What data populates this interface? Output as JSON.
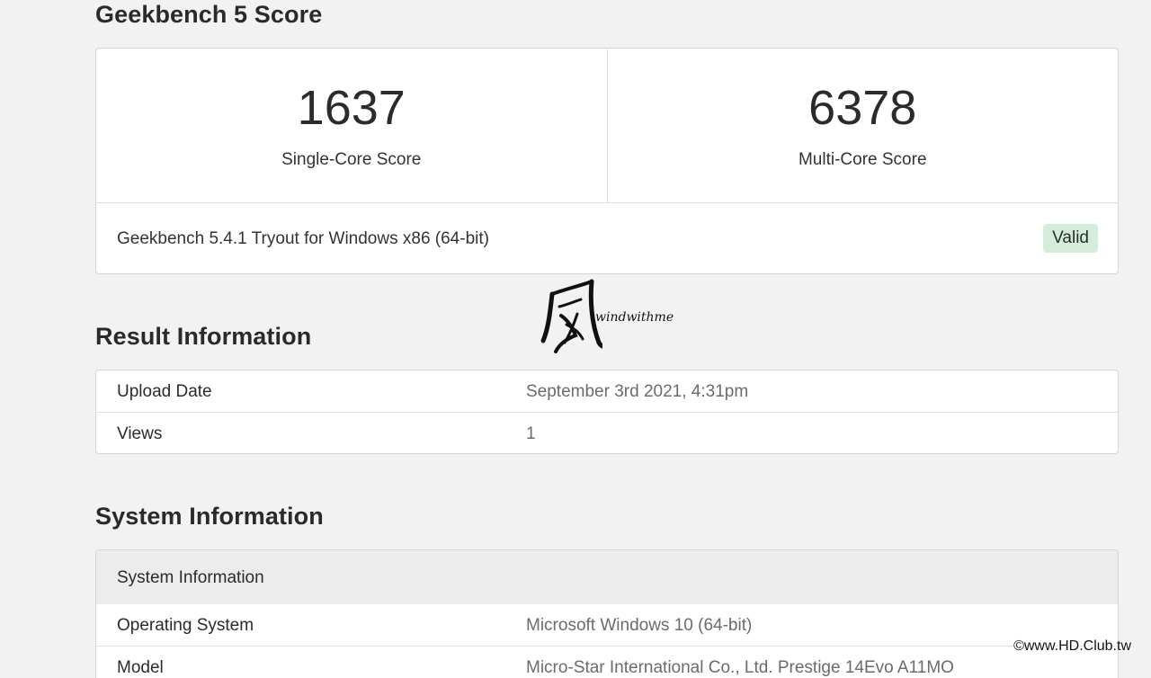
{
  "score_section": {
    "title": "Geekbench 5 Score",
    "single_core_value": "1637",
    "single_core_label": "Single-Core Score",
    "multi_core_value": "6378",
    "multi_core_label": "Multi-Core Score",
    "version": "Geekbench 5.4.1 Tryout for Windows x86 (64-bit)",
    "valid_badge": "Valid"
  },
  "result_section": {
    "title": "Result Information",
    "rows": [
      {
        "label": "Upload Date",
        "value": "September 3rd 2021, 4:31pm"
      },
      {
        "label": "Views",
        "value": "1"
      }
    ]
  },
  "system_section": {
    "title": "System Information",
    "header": "System Information",
    "rows": [
      {
        "label": "Operating System",
        "value": "Microsoft Windows 10 (64-bit)"
      },
      {
        "label": "Model",
        "value": "Micro-Star International Co., Ltd. Prestige 14Evo A11MO"
      }
    ]
  },
  "watermarks": {
    "logo_text": "windwithme",
    "site": "©www.HD.Club.tw"
  },
  "colors": {
    "page_bg": "#f2f2f2",
    "card_bg": "#ffffff",
    "valid_badge_bg": "#d4edda",
    "muted_value": "#6b6b6b"
  }
}
